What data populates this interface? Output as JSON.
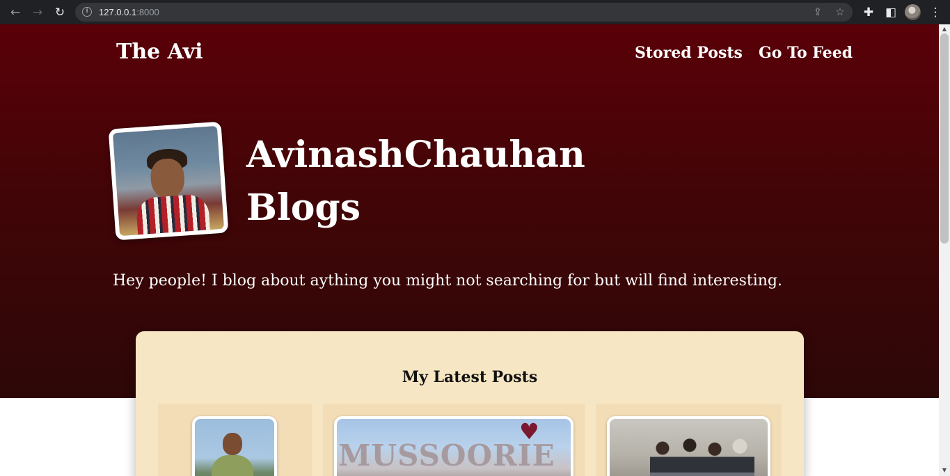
{
  "browser": {
    "url_host": "127.0.0.1",
    "url_port": ":8000",
    "back_icon": "arrow-left-icon",
    "forward_icon": "arrow-right-icon",
    "reload_icon": "reload-icon",
    "info_icon": "info-icon",
    "share_icon": "share-icon",
    "bookmark_icon": "star-icon",
    "extensions_icon": "puzzle-icon",
    "sidepanel_icon": "side-panel-icon",
    "menu_icon": "kebab-menu-icon"
  },
  "site": {
    "brand": "The Avi",
    "nav": [
      "Stored Posts",
      "Go To Feed"
    ]
  },
  "hero": {
    "title_line1": "AvinashChauhan",
    "title_line2": "Blogs",
    "tagline": "Hey people! I blog about aything you might not searching for but will find interesting."
  },
  "latest": {
    "heading": "My Latest Posts",
    "post2_sign_text": "MUSSOORIE"
  },
  "colors": {
    "hero_top": "#5a0008",
    "hero_bottom": "#2d0707",
    "card_bg": "#f7e6c4",
    "post_bg": "#f2ddb7"
  }
}
